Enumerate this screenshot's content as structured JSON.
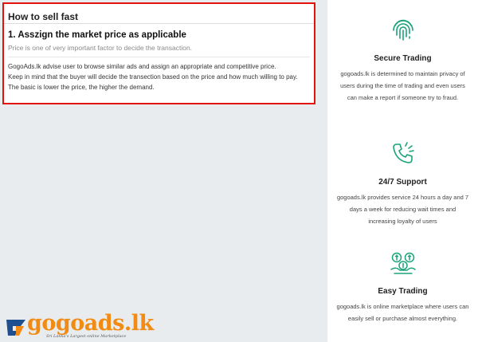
{
  "tips": {
    "title": "How to sell fast",
    "subtitle": "1. Asszign the market price as applicable",
    "intro": "Price is one of very important factor to decide the transaction.",
    "lines": [
      "GogoAds.lk advise user to browse similar ads and assign an appropriate and competitive price.",
      "Keep in mind that the buyer will decide the transection based on the price and how much willing to pay.",
      "The basic is lower the price, the higher the demand."
    ]
  },
  "features": [
    {
      "icon": "fingerprint-icon",
      "title": "Secure Trading",
      "desc": "gogoads.lk is determined to maintain privacy of users during the time of trading and even users can make a report if someone try to fraud."
    },
    {
      "icon": "phone-ringing-icon",
      "title": "24/7 Support",
      "desc": "gogoads.lk provides service 24 hours a day and 7 days a week for reducing wait times and increasing loyalty of users"
    },
    {
      "icon": "money-exchange-icon",
      "title": "Easy Trading",
      "desc": "gogoads.lk is online marketplace where users can easily sell or purchase almost everything."
    }
  ],
  "brand": {
    "name": "gogoads.lk",
    "tagline": "Sri Lanka's Largest online Marketplace"
  },
  "colors": {
    "accent_green": "#1aa37a",
    "highlight_border": "#e3120b",
    "brand_orange": "#f28b13",
    "brand_blue": "#1d4f91"
  }
}
